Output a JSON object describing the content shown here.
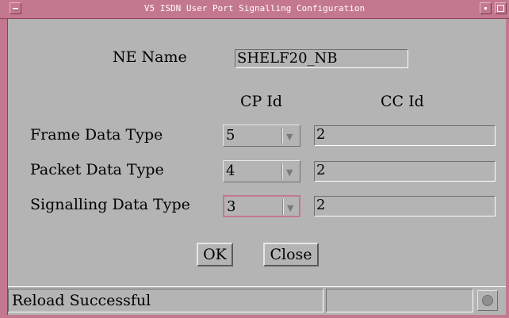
{
  "window": {
    "title": "V5 ISDN User Port Signalling Configuration"
  },
  "ne_name": {
    "label": "NE Name",
    "value": "SHELF20_NB"
  },
  "columns": {
    "cp_id": "CP Id",
    "cc_id": "CC Id"
  },
  "rows": [
    {
      "label": "Frame Data Type",
      "cp_id": "5",
      "cc_id": "2"
    },
    {
      "label": "Packet Data Type",
      "cp_id": "4",
      "cc_id": "2"
    },
    {
      "label": "Signalling Data Type",
      "cp_id": "3",
      "cc_id": "2"
    }
  ],
  "buttons": {
    "ok": "OK",
    "close": "Close"
  },
  "status": {
    "message": "Reload Successful"
  },
  "icons": {
    "window_menu": "window-menu-icon",
    "minimize": "minimize-icon",
    "maximize": "maximize-icon",
    "combo_arrow": "chevron-down-icon",
    "status": "status-indicator-icon"
  },
  "colors": {
    "frame": "#c4788f",
    "background": "#b4b4b4",
    "focus": "#c4788f"
  }
}
